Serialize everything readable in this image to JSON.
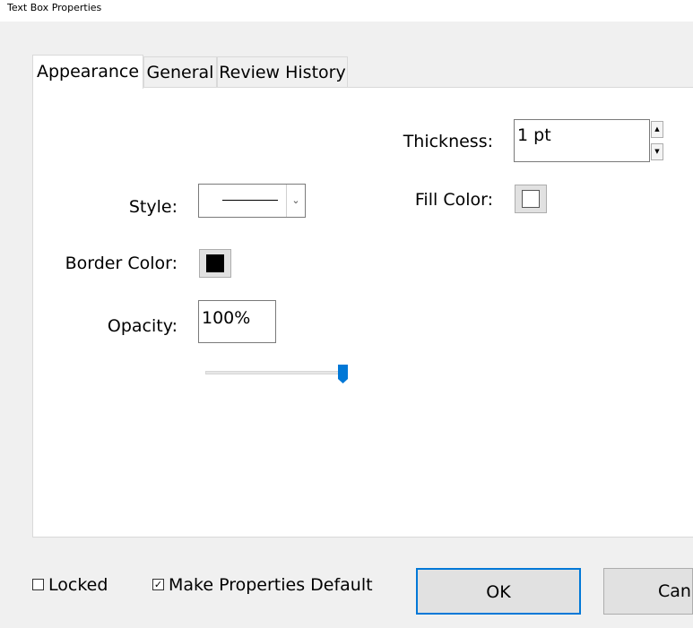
{
  "window": {
    "title": "Text Box Properties"
  },
  "tabs": [
    {
      "label": "Appearance",
      "active": true
    },
    {
      "label": "General",
      "active": false
    },
    {
      "label": "Review History",
      "active": false
    }
  ],
  "appearance": {
    "thickness": {
      "label": "Thickness:",
      "value": "1 pt"
    },
    "style": {
      "label": "Style:",
      "selected": "solid-line"
    },
    "fill_color": {
      "label": "Fill Color:",
      "color": "#ffffff"
    },
    "border_color": {
      "label": "Border Color:",
      "color": "#000000"
    },
    "opacity": {
      "label": "Opacity:",
      "value": "100%",
      "slider_percent": 100
    }
  },
  "footer": {
    "locked": {
      "label": "Locked",
      "checked": false
    },
    "make_default": {
      "label": "Make Properties Default",
      "checked": true
    },
    "ok_label": "OK",
    "cancel_label": "Cancel"
  },
  "colors": {
    "accent": "#0078d7"
  },
  "icons": {
    "spin_up": "triangle-up-icon",
    "spin_down": "triangle-down-icon",
    "dropdown": "chevron-down-icon",
    "check": "check-icon"
  }
}
